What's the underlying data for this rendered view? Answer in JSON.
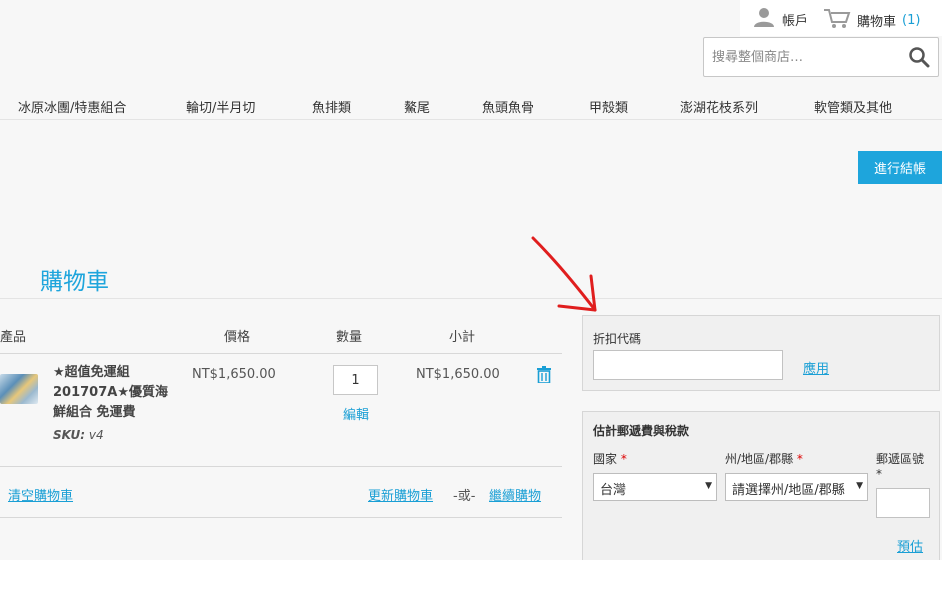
{
  "header": {
    "account_label": "帳戶",
    "cart_label": "購物車",
    "cart_count": "(1)",
    "search_placeholder": "搜尋整個商店…"
  },
  "nav": {
    "items": [
      "冰原冰團/特惠組合",
      "輪切/半月切",
      "魚排類",
      "鰲尾",
      "魚頭魚骨",
      "甲殼類",
      "澎湖花枝系列",
      "軟管類及其他"
    ]
  },
  "checkout_button": "進行結帳",
  "page_title": "購物車",
  "table": {
    "headers": [
      "產品",
      "價格",
      "數量",
      "小計"
    ],
    "item": {
      "name": "★超值免運組 201707A★優質海鮮組合 免運費",
      "sku_label": "SKU:",
      "sku_value": "v4",
      "price": "NT$1,650.00",
      "qty": "1",
      "edit_label": "編輯",
      "subtotal": "NT$1,650.00"
    }
  },
  "actions": {
    "clear_cart": "清空購物車",
    "update_cart": "更新購物車",
    "or": "-或-",
    "continue_shopping": "繼續購物"
  },
  "discount": {
    "label": "折扣代碼",
    "apply_label": "應用"
  },
  "estimate": {
    "title": "估計郵遞費與稅款",
    "country_label": "國家",
    "country_value": "台灣",
    "region_label": "州/地區/郡縣",
    "region_value": "請選擇州/地區/郡縣",
    "zip_label": "郵遞區號",
    "required_mark": "*",
    "estimate_label": "預估"
  },
  "colors": {
    "accent": "#1ea5dc",
    "link": "#1a9fd5",
    "annotation_arrow": "#e01e1e"
  }
}
